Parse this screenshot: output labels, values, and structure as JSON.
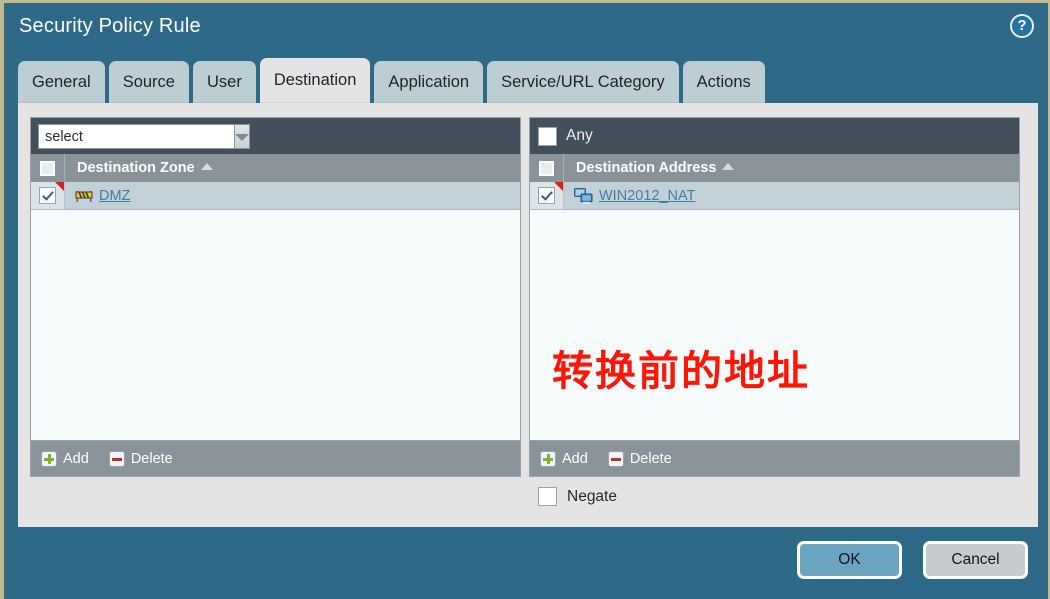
{
  "dialog": {
    "title": "Security Policy Rule",
    "help_icon": "help-circle-icon",
    "accent_color": "#2e6a88",
    "frame_color": "#c3b991"
  },
  "tabs": [
    {
      "label": "General",
      "active": false
    },
    {
      "label": "Source",
      "active": false
    },
    {
      "label": "User",
      "active": false
    },
    {
      "label": "Destination",
      "active": true
    },
    {
      "label": "Application",
      "active": false
    },
    {
      "label": "Service/URL Category",
      "active": false
    },
    {
      "label": "Actions",
      "active": false
    }
  ],
  "zone_panel": {
    "select": {
      "value": "select",
      "placeholder": "select"
    },
    "column_header": "Destination Zone",
    "sort_direction": "ascending",
    "header_checkbox_checked": false,
    "rows": [
      {
        "label": "DMZ",
        "checked": true,
        "icon": "zone-barrier-icon",
        "modified": true
      }
    ],
    "toolbar": {
      "add": "Add",
      "delete": "Delete"
    }
  },
  "address_panel": {
    "any_label": "Any",
    "any_checked": false,
    "column_header": "Destination Address",
    "sort_direction": "ascending",
    "header_checkbox_checked": false,
    "rows": [
      {
        "label": "WIN2012_NAT",
        "checked": true,
        "icon": "address-object-icon",
        "modified": true
      }
    ],
    "toolbar": {
      "add": "Add",
      "delete": "Delete"
    }
  },
  "negate": {
    "label": "Negate",
    "checked": false
  },
  "annotation": {
    "text": "转换前的地址",
    "color": "#ff1505"
  },
  "footer": {
    "ok_label": "OK",
    "cancel_label": "Cancel"
  }
}
